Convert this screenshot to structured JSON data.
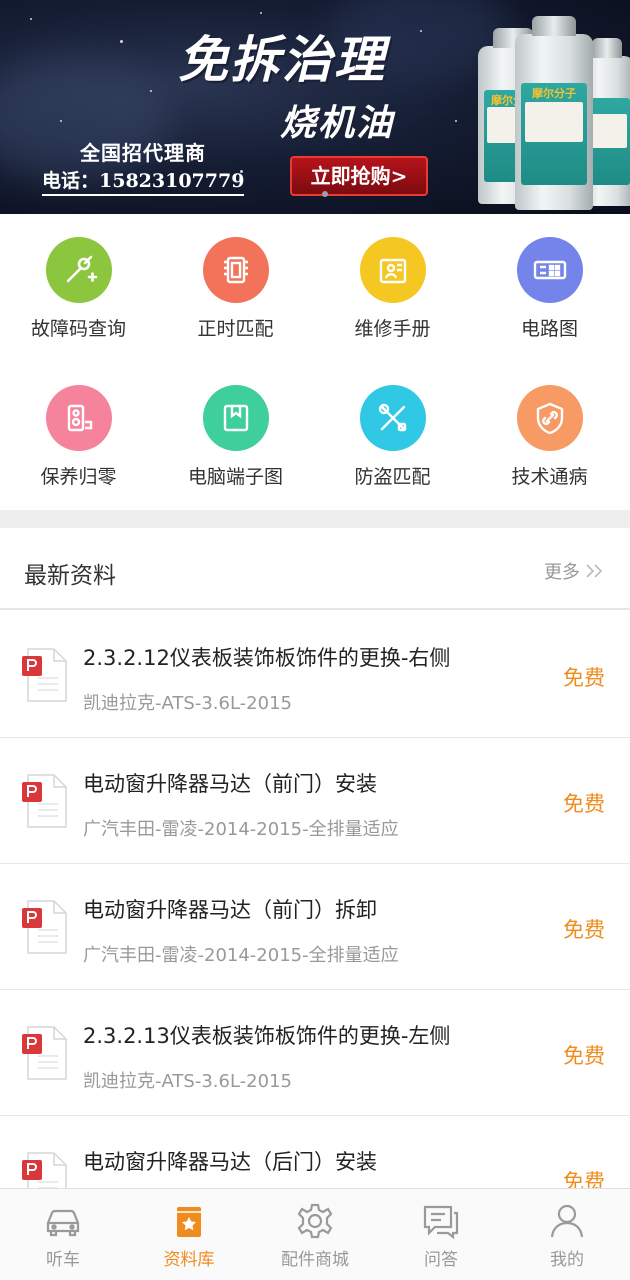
{
  "banner": {
    "title_line1": "免拆治理",
    "title_line2": "烧机油",
    "agent_text": "全国招代理商",
    "phone_text": "电话：15823107779",
    "button_label": "立即抢购>",
    "product_brand": "摩尔分子"
  },
  "categories": [
    {
      "label": "故障码查询",
      "color": "#8cc63f",
      "icon": "wrench-icon"
    },
    {
      "label": "正时匹配",
      "color": "#f2735a",
      "icon": "chip-icon"
    },
    {
      "label": "维修手册",
      "color": "#f5c723",
      "icon": "manual-icon"
    },
    {
      "label": "电路图",
      "color": "#7584ea",
      "icon": "circuit-icon"
    },
    {
      "label": "保养归零",
      "color": "#f6839c",
      "icon": "maintenance-icon"
    },
    {
      "label": "电脑端子图",
      "color": "#3ecf9a",
      "icon": "terminal-icon"
    },
    {
      "label": "防盗匹配",
      "color": "#30c8e4",
      "icon": "tools-icon"
    },
    {
      "label": "技术通病",
      "color": "#f79a63",
      "icon": "shield-link-icon"
    }
  ],
  "latest": {
    "title": "最新资料",
    "more_label": "更多",
    "items": [
      {
        "title": "2.3.2.12仪表板装饰板饰件的更换-右侧",
        "subtitle": "凯迪拉克-ATS-3.6L-2015",
        "price": "免费"
      },
      {
        "title": "电动窗升降器马达（前门）安装",
        "subtitle": "广汽丰田-雷凌-2014-2015-全排量适应",
        "price": "免费"
      },
      {
        "title": "电动窗升降器马达（前门）拆卸",
        "subtitle": "广汽丰田-雷凌-2014-2015-全排量适应",
        "price": "免费"
      },
      {
        "title": "2.3.2.13仪表板装饰板饰件的更换-左侧",
        "subtitle": "凯迪拉克-ATS-3.6L-2015",
        "price": "免费"
      },
      {
        "title": "电动窗升降器马达（后门）安装",
        "subtitle": "",
        "price": "免费"
      }
    ]
  },
  "tabs": [
    {
      "label": "听车",
      "icon": "car-icon",
      "active": false
    },
    {
      "label": "资料库",
      "icon": "library-icon",
      "active": true
    },
    {
      "label": "配件商城",
      "icon": "gear-icon",
      "active": false
    },
    {
      "label": "问答",
      "icon": "chat-icon",
      "active": false
    },
    {
      "label": "我的",
      "icon": "user-icon",
      "active": false
    }
  ],
  "colors": {
    "accent": "#f08c1d",
    "inactive_tab": "#999999",
    "pdf_red": "#d9373a"
  }
}
